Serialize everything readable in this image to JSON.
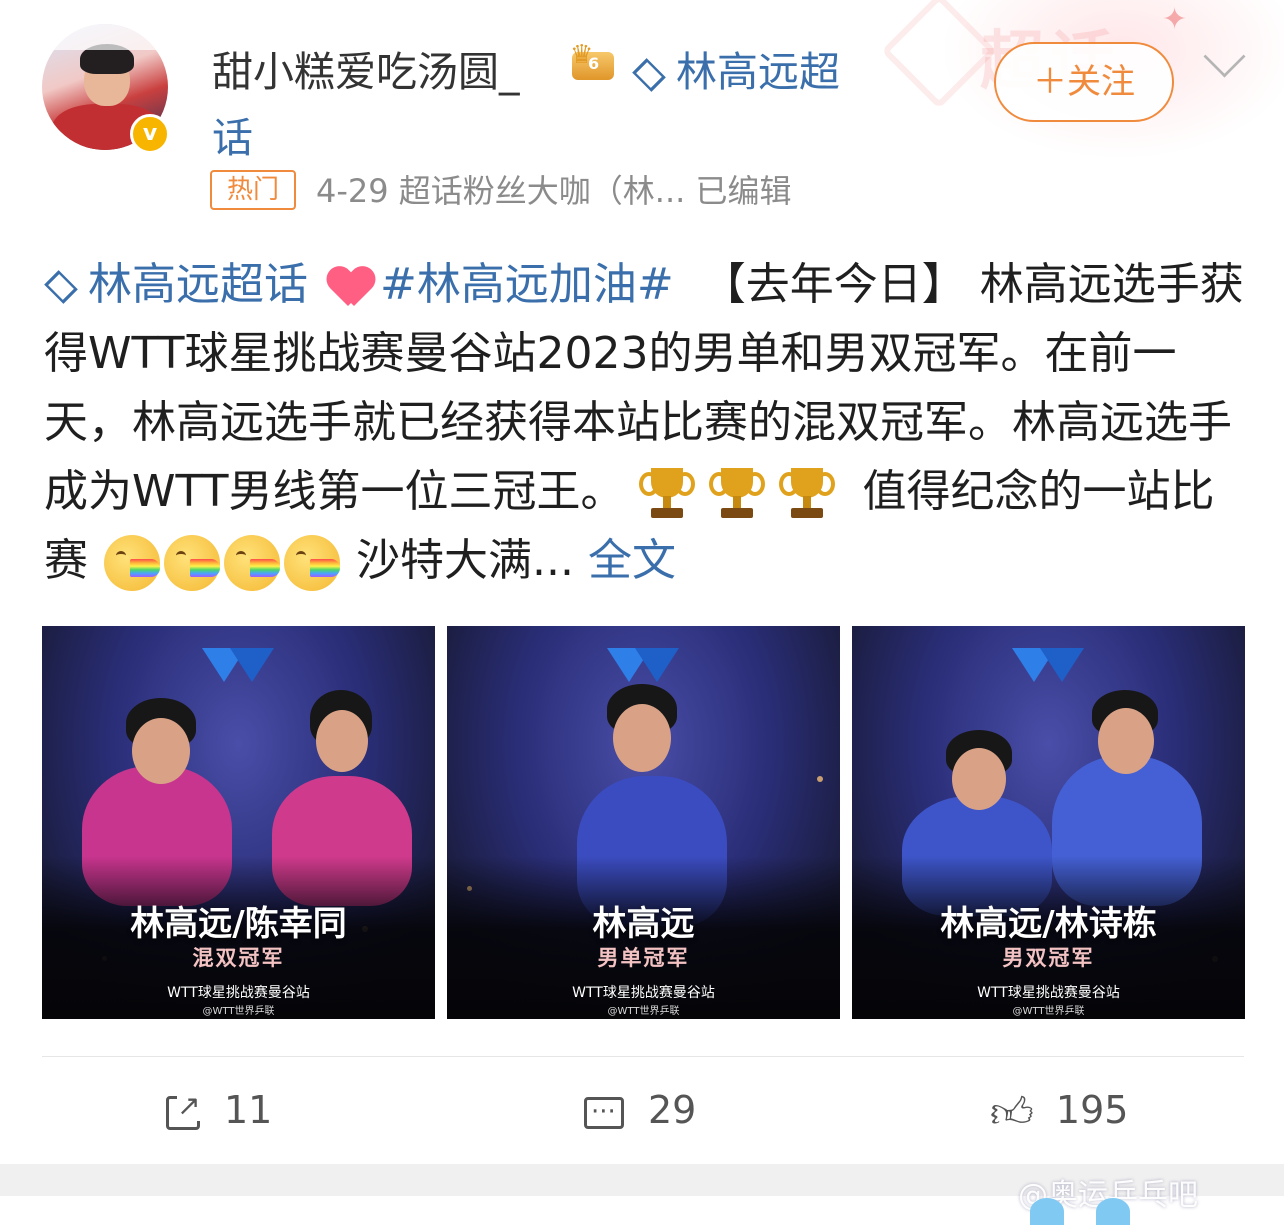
{
  "post": {
    "username": "甜小糕爱吃汤圆_",
    "level_badge": "6",
    "topic_line1": "林高远超",
    "topic_line2": "话",
    "hot_label": "热门",
    "meta": "4-29  超话粉丝大咖（林...  已编辑",
    "follow_label": "＋关注",
    "text": {
      "topic_tag": "林高远超话",
      "hashtag": "#林高远加油#",
      "segment1": "【去年今日】 林高远选手获得WTT球星挑战赛曼谷站2023的男单和男双冠军。在前一天，林高远选手就已经获得本站比赛的混双冠军。林高远选手成为WTT男线第一位三冠王。",
      "segment2": "值得纪念的一站比赛",
      "segment3": "沙特大满...",
      "more_link": "全文"
    }
  },
  "images": [
    {
      "title": "林高远/陈幸同",
      "subtitle": "混双冠军",
      "event": "WTT球星挑战赛曼谷站",
      "source": "@WTT世界乒联"
    },
    {
      "title": "林高远",
      "subtitle": "男单冠军",
      "event": "WTT球星挑战赛曼谷站",
      "source": "@WTT世界乒联"
    },
    {
      "title": "林高远/林诗栋",
      "subtitle": "男双冠军",
      "event": "WTT球星挑战赛曼谷站",
      "source": "@WTT世界乒联"
    }
  ],
  "actions": {
    "share_count": "11",
    "comment_count": "29",
    "like_count": "195"
  },
  "watermark": "@奥运乒乓吧",
  "deco_text": "超话",
  "colors": {
    "link_blue": "#3a6fab",
    "orange": "#f08a3c",
    "gold": "#f7b500"
  }
}
